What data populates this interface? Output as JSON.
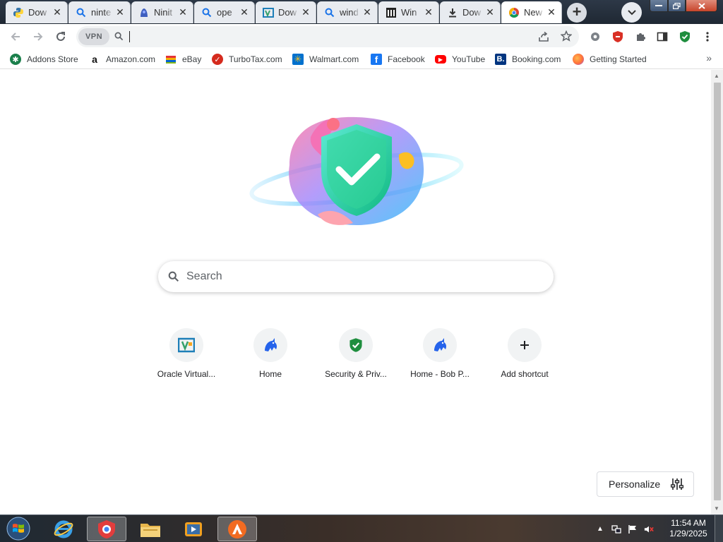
{
  "browser": {
    "tabs": [
      {
        "title": "Dow",
        "icon": "python-icon",
        "active": false
      },
      {
        "title": "ninte",
        "icon": "search-icon",
        "active": false
      },
      {
        "title": "Ninit",
        "icon": "ninite-icon",
        "active": false
      },
      {
        "title": "ope",
        "icon": "search-icon",
        "active": false
      },
      {
        "title": "Dow",
        "icon": "virtualbox-icon",
        "active": false
      },
      {
        "title": "wind",
        "icon": "search-icon",
        "active": false
      },
      {
        "title": "Win",
        "icon": "archive-icon",
        "active": false
      },
      {
        "title": "Dow",
        "icon": "download-icon",
        "active": false
      },
      {
        "title": "New",
        "icon": "chrome-icon",
        "active": true
      }
    ],
    "toolbar": {
      "vpn_label": "VPN",
      "omnibox_value": ""
    },
    "bookmarks": [
      {
        "label": "Addons Store",
        "icon": "addons-icon",
        "color": "#1a7f4b"
      },
      {
        "label": "Amazon.com",
        "icon": "amazon-icon",
        "color": "#ffffff"
      },
      {
        "label": "eBay",
        "icon": "ebay-icon",
        "color": "#e53238"
      },
      {
        "label": "TurboTax.com",
        "icon": "turbotax-icon",
        "color": "#d52b1e"
      },
      {
        "label": "Walmart.com",
        "icon": "walmart-icon",
        "color": "#0071ce"
      },
      {
        "label": "Facebook",
        "icon": "facebook-icon",
        "color": "#1877f2"
      },
      {
        "label": "YouTube",
        "icon": "youtube-icon",
        "color": "#ff0000"
      },
      {
        "label": "Booking.com",
        "icon": "booking-icon",
        "color": "#003580"
      },
      {
        "label": "Getting Started",
        "icon": "firefox-icon",
        "color": "#ff7139"
      }
    ],
    "bookmarks_more": "»"
  },
  "newtab": {
    "search_placeholder": "Search",
    "shortcuts": [
      {
        "label": "Oracle Virtual...",
        "icon": "virtualbox-icon"
      },
      {
        "label": "Home",
        "icon": "dragon-icon"
      },
      {
        "label": "Security & Priv...",
        "icon": "shield-check-icon"
      },
      {
        "label": "Home - Bob P...",
        "icon": "dragon-icon"
      },
      {
        "label": "Add shortcut",
        "icon": "plus-icon"
      }
    ],
    "personalize_label": "Personalize"
  },
  "taskbar": {
    "time": "11:54 AM",
    "date": "1/29/2025"
  },
  "colors": {
    "accent": "#1a73e8",
    "shield_green": "#1e8e3e",
    "tabstrip": "#1f2833"
  }
}
